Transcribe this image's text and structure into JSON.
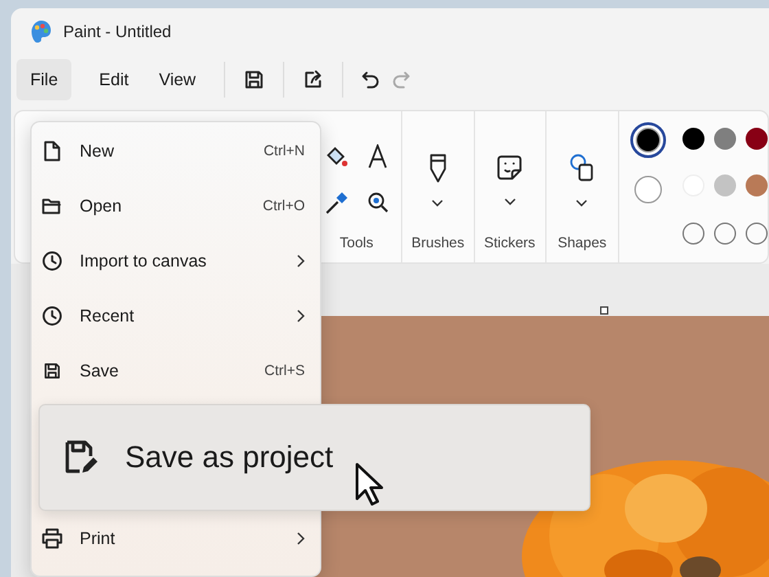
{
  "window": {
    "title": "Paint - Untitled"
  },
  "menu_bar": [
    {
      "label": "File",
      "selected": true
    },
    {
      "label": "Edit",
      "selected": false
    },
    {
      "label": "View",
      "selected": false
    }
  ],
  "quick_actions": [
    {
      "kind": "save",
      "disabled": false
    },
    {
      "kind": "share",
      "disabled": false
    },
    {
      "kind": "undo",
      "disabled": false
    },
    {
      "kind": "redo",
      "disabled": true
    }
  ],
  "ribbon": {
    "groups": [
      {
        "kind": "tools",
        "label": "Tools"
      },
      {
        "kind": "brushes",
        "label": "Brushes"
      },
      {
        "kind": "stickers",
        "label": "Stickers"
      },
      {
        "kind": "shapes",
        "label": "Shapes"
      }
    ],
    "current_colors": [
      {
        "color": "#000000",
        "selected": true
      },
      {
        "color": "#ffffff",
        "selected": false
      }
    ],
    "swatches": [
      {
        "kind": "color",
        "color": "#000000"
      },
      {
        "kind": "color",
        "color": "#7f7f7f"
      },
      {
        "kind": "color",
        "color": "#880015"
      },
      {
        "kind": "color",
        "color": "#ffffff"
      },
      {
        "kind": "color",
        "color": "#c3c3c3"
      },
      {
        "kind": "color",
        "color": "#b97a57"
      },
      {
        "kind": "empty"
      },
      {
        "kind": "empty"
      },
      {
        "kind": "empty"
      }
    ]
  },
  "file_menu": {
    "items": [
      {
        "kind": "new",
        "label": "New",
        "shortcut": "Ctrl+N",
        "submenu": false,
        "highlighted": false
      },
      {
        "kind": "open",
        "label": "Open",
        "shortcut": "Ctrl+O",
        "submenu": false,
        "highlighted": false
      },
      {
        "kind": "import",
        "label": "Import to canvas",
        "submenu": true,
        "highlighted": false
      },
      {
        "kind": "recent",
        "label": "Recent",
        "submenu": true,
        "highlighted": false
      },
      {
        "kind": "save",
        "label": "Save",
        "shortcut": "Ctrl+S",
        "submenu": false,
        "highlighted": false
      },
      {
        "kind": "project",
        "label": "Save as project",
        "submenu": false,
        "highlighted": true
      },
      {
        "kind": "print",
        "label": "Print",
        "submenu": true,
        "highlighted": false
      }
    ]
  }
}
